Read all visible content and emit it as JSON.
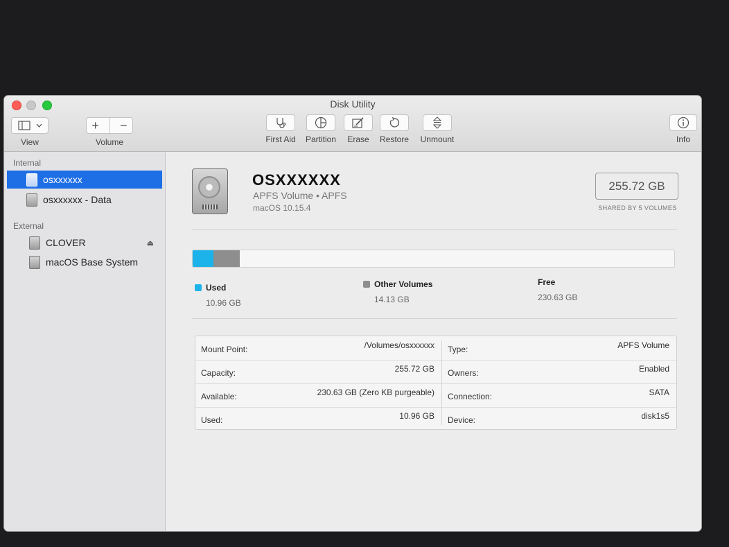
{
  "window": {
    "title": "Disk Utility"
  },
  "toolbar": {
    "view_label": "View",
    "volume_label": "Volume",
    "add_symbol": "+",
    "remove_symbol": "−",
    "first_aid_label": "First Aid",
    "partition_label": "Partition",
    "erase_label": "Erase",
    "restore_label": "Restore",
    "unmount_label": "Unmount",
    "info_label": "Info"
  },
  "sidebar": {
    "internal_header": "Internal",
    "external_header": "External",
    "internal_items": [
      {
        "label": "osxxxxxx",
        "selected": true
      },
      {
        "label": "osxxxxxx - Data",
        "selected": false
      }
    ],
    "external_items": [
      {
        "label": "CLOVER",
        "eject": true
      },
      {
        "label": "macOS Base System",
        "eject": false
      }
    ]
  },
  "volume": {
    "name": "OSXXXXXX",
    "type": "APFS Volume • APFS",
    "os": "macOS 10.15.4",
    "capacity": "255.72 GB",
    "capacity_note": "SHARED BY 5 VOLUMES"
  },
  "usage": {
    "used": {
      "label": "Used",
      "value": "10.96 GB",
      "gb": 10.96,
      "color": "#1cb3ea"
    },
    "other": {
      "label": "Other Volumes",
      "value": "14.13 GB",
      "gb": 14.13,
      "color": "#8e8e8e"
    },
    "free": {
      "label": "Free",
      "value": "230.63 GB",
      "gb": 230.63,
      "color": "#f6f6f6"
    },
    "total_gb": 255.72
  },
  "details": {
    "left": [
      {
        "label": "Mount Point:",
        "value": "/Volumes/osxxxxxx"
      },
      {
        "label": "Capacity:",
        "value": "255.72 GB"
      },
      {
        "label": "Available:",
        "value": "230.63 GB (Zero KB purgeable)"
      },
      {
        "label": "Used:",
        "value": "10.96 GB"
      }
    ],
    "right": [
      {
        "label": "Type:",
        "value": "APFS Volume"
      },
      {
        "label": "Owners:",
        "value": "Enabled"
      },
      {
        "label": "Connection:",
        "value": "SATA"
      },
      {
        "label": "Device:",
        "value": "disk1s5"
      }
    ]
  }
}
